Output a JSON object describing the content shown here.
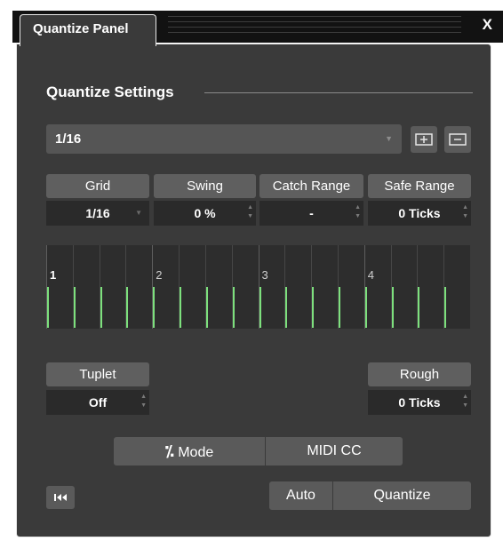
{
  "window": {
    "tab_title": "Quantize Panel",
    "close_label": "X"
  },
  "section_title": "Quantize Settings",
  "preset": {
    "value": "1/16"
  },
  "params": {
    "grid": {
      "label": "Grid",
      "value": "1/16"
    },
    "swing": {
      "label": "Swing",
      "value": "0 %"
    },
    "catch_range": {
      "label": "Catch Range",
      "value": "-"
    },
    "safe_range": {
      "label": "Safe Range",
      "value": "0 Ticks"
    },
    "tuplet": {
      "label": "Tuplet",
      "value": "Off"
    },
    "rough": {
      "label": "Rough",
      "value": "0 Ticks"
    }
  },
  "grid_display": {
    "beats": [
      "1",
      "2",
      "3",
      "4"
    ],
    "grid_lines_per_beat": 4
  },
  "mode_button": {
    "label": "Mode",
    "icon": "percent-slash-icon"
  },
  "midi_cc_button": {
    "label": "MIDI CC"
  },
  "reset_button": {
    "icon": "skip-to-start-icon"
  },
  "auto_button": {
    "label": "Auto"
  },
  "quantize_button": {
    "label": "Quantize"
  },
  "icons": {
    "add_preset": "add-preset-icon",
    "remove_preset": "remove-preset-icon"
  },
  "colors": {
    "accent_green": "#7de07d",
    "panel_bg": "#3a3a3a",
    "field_bg": "#2a2a2a"
  }
}
